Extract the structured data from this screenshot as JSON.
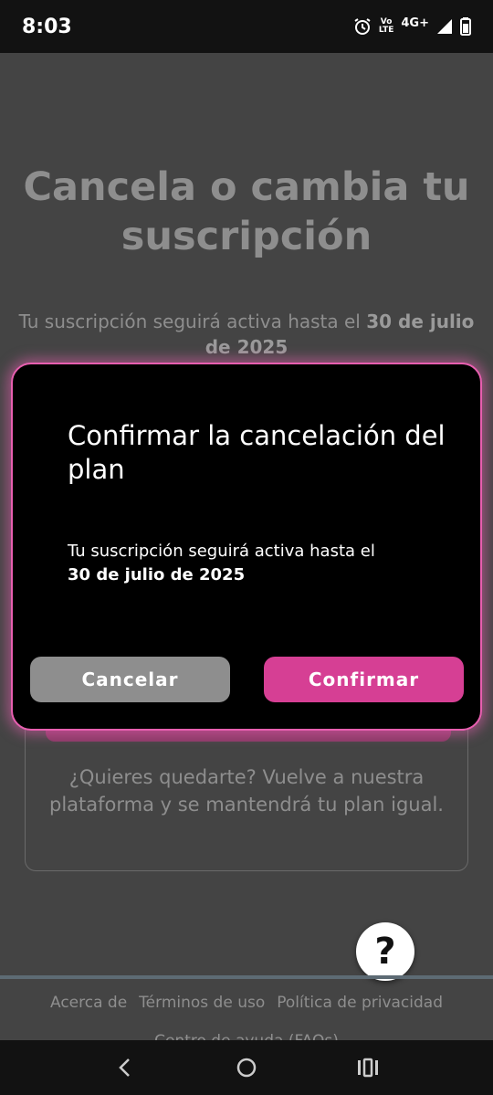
{
  "status_bar": {
    "time": "8:03",
    "volte_top": "Vo",
    "volte_bottom": "LTE",
    "network": "4G+"
  },
  "background": {
    "title": "Cancela o cambia tu suscripción",
    "subtitle_prefix": "Tu suscripción seguirá activa hasta el ",
    "subtitle_date": "30 de julio de 2025",
    "card_text": "¿Quieres quedarte? Vuelve a nuestra plataforma y se mantendrá tu plan igual."
  },
  "help": {
    "label": "?"
  },
  "footer": {
    "links": [
      "Acerca de",
      "Términos de uso",
      "Política de privacidad"
    ],
    "more": "Centro de ayuda (FAQs)"
  },
  "dialog": {
    "title": "Confirmar la cancelación del plan",
    "message_prefix": "Tu suscripción seguirá activa hasta el",
    "message_date": "30 de julio de 2025",
    "cancel_label": "Cancelar",
    "confirm_label": "Confirmar"
  },
  "colors": {
    "accent": "#d63f94",
    "dialog_border": "#e85fb0",
    "overlay": "#444444"
  }
}
